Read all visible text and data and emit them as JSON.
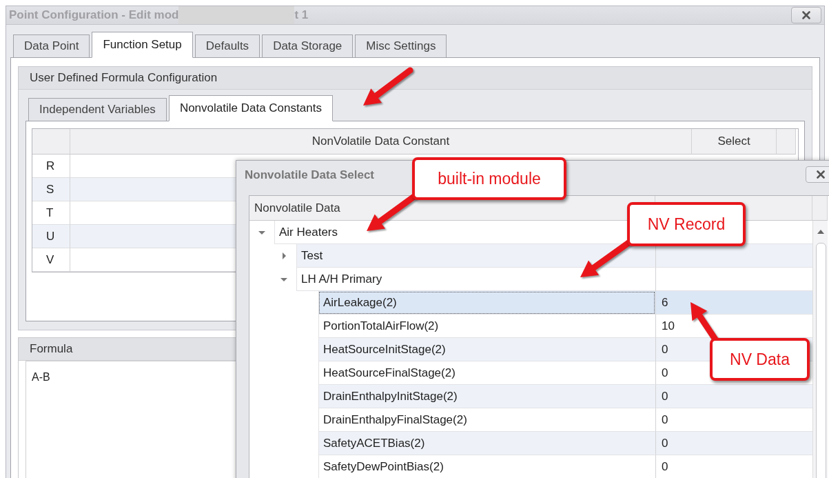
{
  "window": {
    "title": "Point Configuration - Edit mod",
    "title_tail": "t 1"
  },
  "tabs": [
    {
      "label": "Data Point",
      "selected": false
    },
    {
      "label": "Function Setup",
      "selected": true
    },
    {
      "label": "Defaults",
      "selected": false
    },
    {
      "label": "Data Storage",
      "selected": false
    },
    {
      "label": "Misc Settings",
      "selected": false
    }
  ],
  "group": {
    "title": "User Defined Formula Configuration",
    "tabs": [
      {
        "label": "Independent Variables",
        "selected": false
      },
      {
        "label": "Nonvolatile Data Constants",
        "selected": true
      }
    ],
    "table": {
      "columns": [
        "NonVolatile Data Constant",
        "Select"
      ],
      "rows": [
        {
          "label": "R"
        },
        {
          "label": "S"
        },
        {
          "label": "T"
        },
        {
          "label": "U"
        },
        {
          "label": "V"
        }
      ]
    }
  },
  "formula": {
    "title": "Formula",
    "value": "A-B"
  },
  "dialog": {
    "title": "Nonvolatile Data Select",
    "column": "Nonvolatile Data",
    "tree": [
      {
        "label": "Air Heaters",
        "expanded": true,
        "selected": false,
        "children": [
          {
            "label": "Test",
            "expanded": false,
            "selected": false
          },
          {
            "label": "LH A/H Primary",
            "expanded": true,
            "selected": false,
            "children": [
              {
                "label": "AirLeakage(2)",
                "value": "6",
                "selected": true
              },
              {
                "label": "PortionTotalAirFlow(2)",
                "value": "10",
                "selected": false
              },
              {
                "label": "HeatSourceInitStage(2)",
                "value": "0",
                "selected": false
              },
              {
                "label": "HeatSourceFinalStage(2)",
                "value": "0",
                "selected": false
              },
              {
                "label": "DrainEnthalpyInitStage(2)",
                "value": "0",
                "selected": false
              },
              {
                "label": "DrainEnthalpyFinalStage(2)",
                "value": "0",
                "selected": false
              },
              {
                "label": "SafetyACETBias(2)",
                "value": "0",
                "selected": false
              },
              {
                "label": "SafetyDewPointBias(2)",
                "value": "0",
                "selected": false
              }
            ]
          }
        ]
      }
    ]
  },
  "annotations": [
    {
      "kind": "arrow"
    },
    {
      "kind": "callout",
      "text": "built-in module"
    },
    {
      "kind": "callout",
      "text": "NV Record"
    },
    {
      "kind": "callout",
      "text": "NV Data"
    }
  ]
}
